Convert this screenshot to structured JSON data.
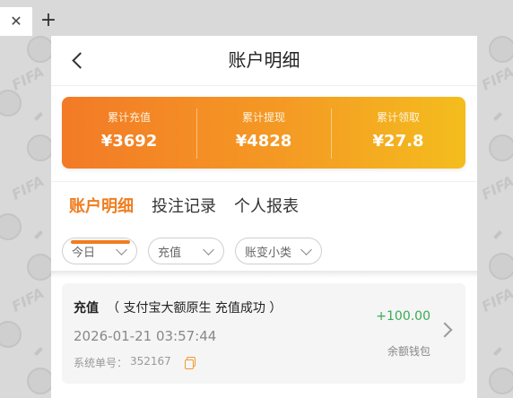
{
  "browser": {
    "close_glyph": "✕",
    "add_glyph": "+"
  },
  "header": {
    "title": "账户明细",
    "back_icon": "chevron-left-icon"
  },
  "summary": {
    "items": [
      {
        "label": "累计充值",
        "value": "¥3692"
      },
      {
        "label": "累计提现",
        "value": "¥4828"
      },
      {
        "label": "累计领取",
        "value": "¥27.8"
      }
    ],
    "gradient": [
      "#f37a26",
      "#f4bd1d"
    ]
  },
  "tabs": [
    {
      "label": "账户明细",
      "active": true
    },
    {
      "label": "投注记录",
      "active": false
    },
    {
      "label": "个人报表",
      "active": false
    }
  ],
  "filters": [
    {
      "label": "今日"
    },
    {
      "label": "充值"
    },
    {
      "label": "账变小类"
    }
  ],
  "record": {
    "type": "充值",
    "note": "（ 支付宝大额原生 充值成功 ）",
    "time": "2026-01-21 03:57:44",
    "order_label": "系统单号：",
    "order_number": "352167",
    "amount": "+100.00",
    "wallet": "余额钱包"
  },
  "colors": {
    "accent": "#ef7d1f",
    "positive": "#3aaa57"
  }
}
